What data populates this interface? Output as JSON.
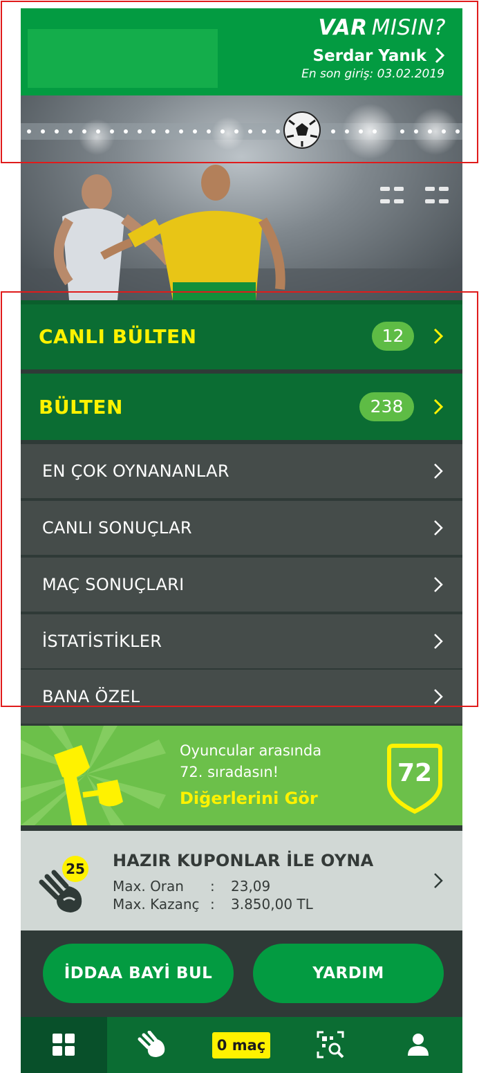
{
  "header": {
    "brand_bold": "VAR",
    "brand_light": "MISIN?",
    "user_name": "Serdar Yanık",
    "last_login": "En son giriş: 03.02.2019"
  },
  "menu": {
    "live_bulletin": {
      "label": "CANLI BÜLTEN",
      "count": "12"
    },
    "bulletin": {
      "label": "BÜLTEN",
      "count": "238"
    },
    "items": [
      {
        "label": "EN ÇOK OYNANANLAR"
      },
      {
        "label": "CANLI SONUÇLAR"
      },
      {
        "label": "MAÇ SONUÇLARI"
      },
      {
        "label": "İSTATİSTİKLER"
      },
      {
        "label": "BANA ÖZEL"
      }
    ]
  },
  "ranking": {
    "line1": "Oyuncular arasında",
    "line2": "72. sıradasın!",
    "link": "Diğerlerini Gör",
    "rank": "72"
  },
  "coupons": {
    "title": "HAZIR KUPONLAR İLE OYNA",
    "badge": "25",
    "max_odds_label": "Max. Oran",
    "max_odds_value": "23,09",
    "max_win_label": "Max. Kazanç",
    "max_win_value": "3.850,00 TL",
    "separator": ":"
  },
  "buttons": {
    "find_dealer": "İDDAA BAYİ BUL",
    "help": "YARDIM"
  },
  "bottom_nav": {
    "match_count": "0 maç"
  },
  "colors": {
    "header_green": "#039b41",
    "menu_green": "#0b6d33",
    "accent_yellow": "#fff200",
    "pill_green": "#5ebc45",
    "row_gray": "#454c4a",
    "annotation_red": "#e01b1b"
  }
}
